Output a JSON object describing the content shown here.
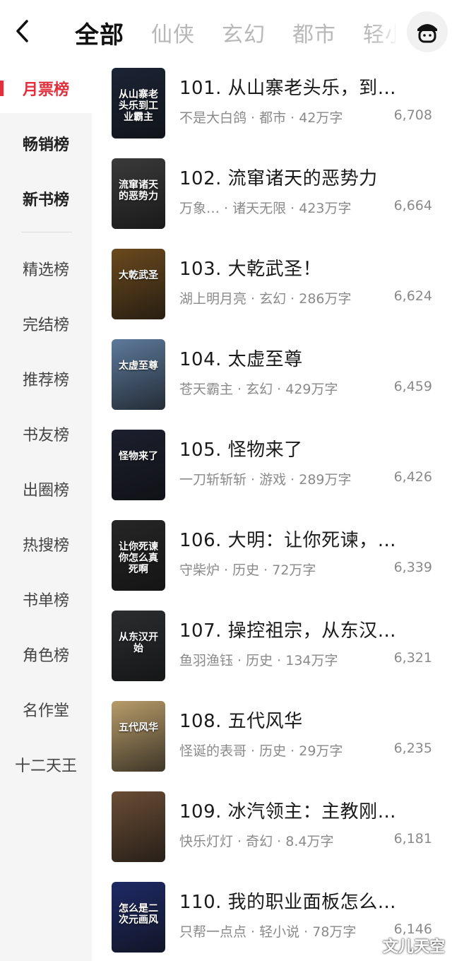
{
  "header": {
    "tabs": [
      "全部",
      "仙侠",
      "玄幻",
      "都市",
      "轻小说"
    ],
    "active_tab": 0
  },
  "sidebar": {
    "items": [
      {
        "label": "月票榜"
      },
      {
        "label": "畅销榜"
      },
      {
        "label": "新书榜"
      },
      {
        "label": "精选榜"
      },
      {
        "label": "完结榜"
      },
      {
        "label": "推荐榜"
      },
      {
        "label": "书友榜"
      },
      {
        "label": "出圈榜"
      },
      {
        "label": "热搜榜"
      },
      {
        "label": "书单榜"
      },
      {
        "label": "角色榜"
      },
      {
        "label": "名作堂"
      },
      {
        "label": "十二天王"
      }
    ]
  },
  "books": [
    {
      "title": "101. 从山寨老头乐，到…",
      "meta": "不是大白鸽 · 都市 · 42万字",
      "votes": "6,708",
      "cover_text": "从山寨老头乐到工业霸主",
      "cover_color": "#1b2436"
    },
    {
      "title": "102. 流窜诸天的恶势力",
      "meta": "万象… · 诸天无限 · 423万字",
      "votes": "6,664",
      "cover_text": "流窜诸天的恶势力",
      "cover_color": "#3a3a3a"
    },
    {
      "title": "103. 大乾武圣！",
      "meta": "湖上明月亮 · 玄幻 · 286万字",
      "votes": "6,624",
      "cover_text": "大乾武圣",
      "cover_color": "#6b4a1e"
    },
    {
      "title": "104. 太虚至尊",
      "meta": "苍天霸主 · 玄幻 · 429万字",
      "votes": "6,459",
      "cover_text": "太虚至尊",
      "cover_color": "#5d7a9c"
    },
    {
      "title": "105. 怪物来了",
      "meta": "一刀斩斩斩 · 游戏 · 289万字",
      "votes": "6,426",
      "cover_text": "怪物来了",
      "cover_color": "#1c1f2e"
    },
    {
      "title": "106. 大明：让你死谏，…",
      "meta": "守柴炉 · 历史 · 72万字",
      "votes": "6,339",
      "cover_text": "让你死谏 你怎么真死啊",
      "cover_color": "#262626"
    },
    {
      "title": "107. 操控祖宗，从东汉…",
      "meta": "鱼羽渔钰 · 历史 · 134万字",
      "votes": "6,321",
      "cover_text": "从东汉开始",
      "cover_color": "#2b2d2f"
    },
    {
      "title": "108. 五代风华",
      "meta": "怪诞的表哥 · 历史 · 29万字",
      "votes": "6,235",
      "cover_text": "五代风华",
      "cover_color": "#b89c6a"
    },
    {
      "title": "109. 冰汽领主：主教刚…",
      "meta": "快乐灯灯 · 奇幻 · 8.4万字",
      "votes": "6,181",
      "cover_text": "",
      "cover_color": "#6a4d35"
    },
    {
      "title": "110. 我的职业面板怎么…",
      "meta": "只帮一点点 · 轻小说 · 78万字",
      "votes": "6,146",
      "cover_text": "怎么是二次元画风",
      "cover_color": "#1e2a66"
    }
  ],
  "watermark": "文儿天空",
  "colors": {
    "accent": "#e0303e",
    "sidebar_bg": "#f5f5f5"
  }
}
